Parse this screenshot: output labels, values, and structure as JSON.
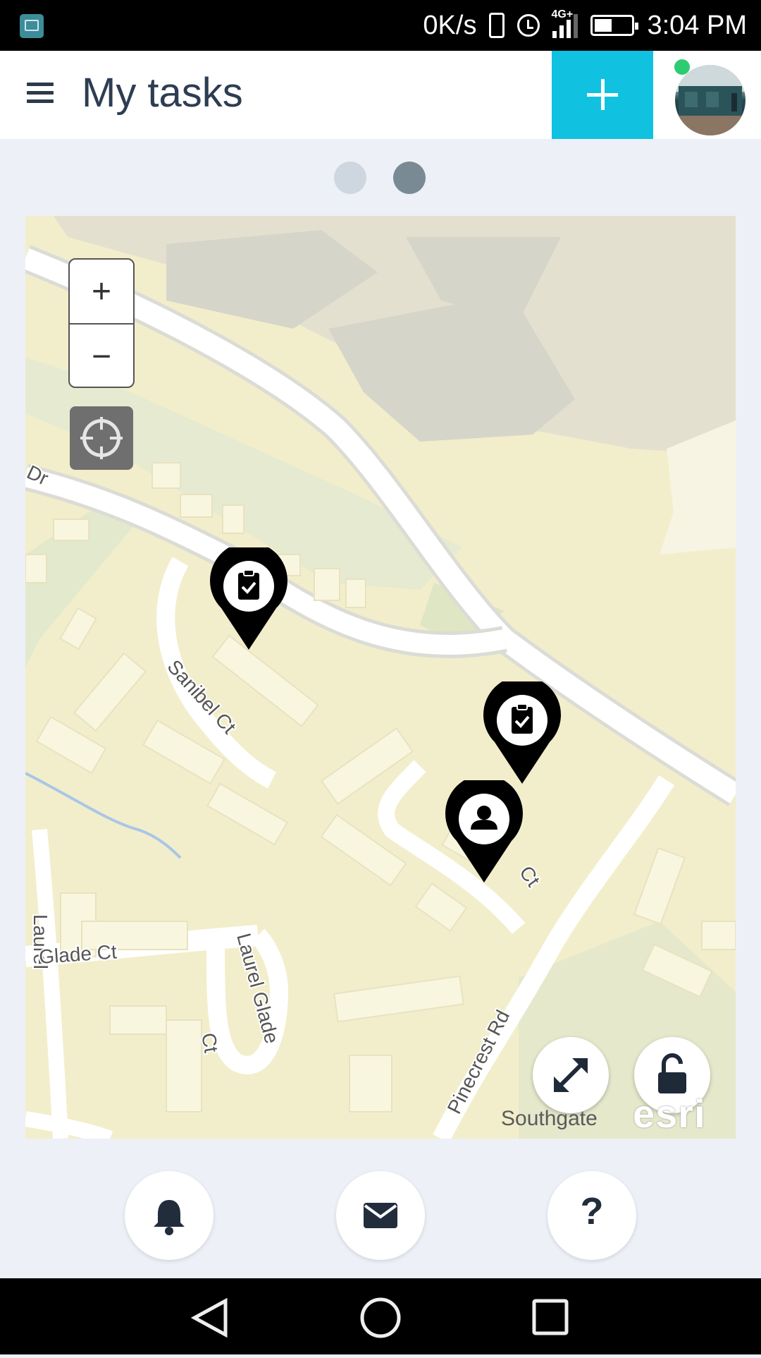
{
  "status_bar": {
    "network_speed": "0K/s",
    "signal_type": "4G+",
    "time": "3:04 PM"
  },
  "app_bar": {
    "title": "My tasks",
    "add_button_icon": "plus-icon",
    "avatar_status_color": "#2ecc71"
  },
  "pager": {
    "pages": 2,
    "active_index": 1
  },
  "map": {
    "zoom_in_label": "+",
    "zoom_out_label": "−",
    "street_labels": [
      "Dr",
      "Sanibel Ct",
      "Ct",
      "Laurel",
      "Glade Ct",
      "Laurel Glade",
      "Ct",
      "Pinecrest Rd"
    ],
    "attribution": "Southgate",
    "logo_text": "esri",
    "markers": [
      {
        "type": "task",
        "icon": "clipboard-check-icon"
      },
      {
        "type": "task",
        "icon": "clipboard-check-icon"
      },
      {
        "type": "person",
        "icon": "person-icon"
      }
    ]
  },
  "bottom_actions": {
    "notifications_icon": "bell-icon",
    "messages_icon": "envelope-icon",
    "help_label": "?"
  },
  "colors": {
    "accent": "#10c2df",
    "title_text": "#2d3d52",
    "background": "#edf0f7"
  }
}
